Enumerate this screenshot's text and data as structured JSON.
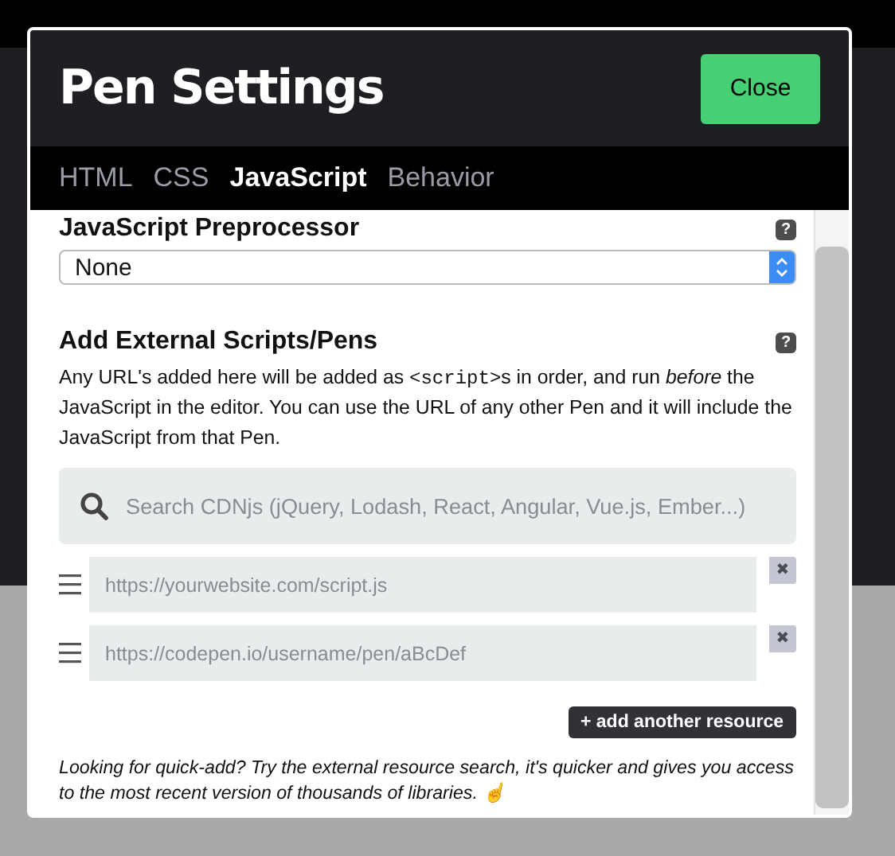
{
  "window": {
    "title": "Pen Settings",
    "close_button": "Close"
  },
  "tabs": [
    {
      "label": "HTML",
      "selected": false
    },
    {
      "label": "CSS",
      "selected": false
    },
    {
      "label": "JavaScript",
      "selected": true
    },
    {
      "label": "Behavior",
      "selected": false
    }
  ],
  "preprocessor": {
    "label": "JavaScript Preprocessor",
    "help": "?",
    "value": "None"
  },
  "external": {
    "label": "Add External Scripts/Pens",
    "help": "?",
    "description": [
      {
        "kind": "text",
        "text": "Any URL's added here will be added as "
      },
      {
        "kind": "code",
        "text": "<script>"
      },
      {
        "kind": "text",
        "text": "s in order, and run *before* the JavaScript in the editor. You can use the URL of any other Pen and it will include the JavaScript from that Pen."
      }
    ],
    "search": {
      "placeholder": "Search CDNjs (jQuery, Lodash, React, Angular, Vue.js, Ember...)"
    },
    "resources": [
      {
        "placeholder": "https://yourwebsite.com/script.js",
        "remove": "✖"
      },
      {
        "placeholder": "https://codepen.io/username/pen/aBcDef",
        "remove": "✖"
      }
    ],
    "add_button": "+ add another resource",
    "note": "Looking for quick-add? Try the external resource search, it's quicker and gives you access to the most recent version of thousands of libraries. ☝"
  }
}
